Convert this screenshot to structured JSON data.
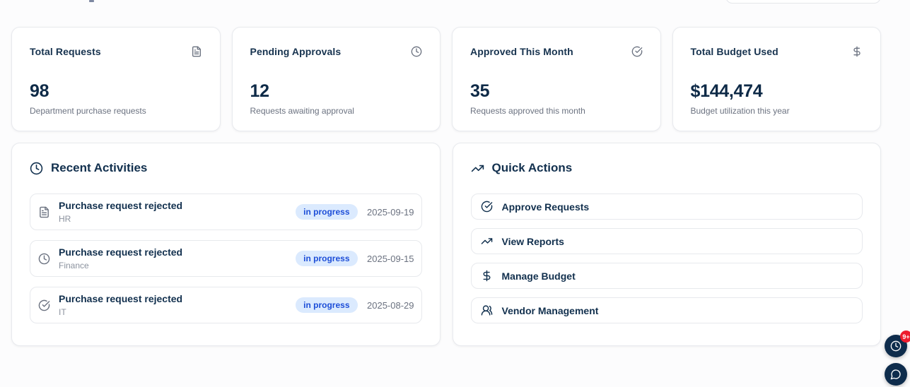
{
  "stats": [
    {
      "title": "Total Requests",
      "icon": "file-text-icon",
      "value": "98",
      "subtitle": "Department purchase requests"
    },
    {
      "title": "Pending Approvals",
      "icon": "clock-icon",
      "value": "12",
      "subtitle": "Requests awaiting approval"
    },
    {
      "title": "Approved This Month",
      "icon": "check-circle-icon",
      "value": "35",
      "subtitle": "Requests approved this month"
    },
    {
      "title": "Total Budget Used",
      "icon": "dollar-icon",
      "value": "$144,474",
      "subtitle": "Budget utilization this year"
    }
  ],
  "recent_activities": {
    "title": "Recent Activities",
    "items": [
      {
        "icon": "file-text-icon",
        "title": "Purchase request rejected",
        "department": "HR",
        "status": "in progress",
        "date": "2025-09-19"
      },
      {
        "icon": "clock-icon",
        "title": "Purchase request rejected",
        "department": "Finance",
        "status": "in progress",
        "date": "2025-09-15"
      },
      {
        "icon": "check-circle-icon",
        "title": "Purchase request rejected",
        "department": "IT",
        "status": "in progress",
        "date": "2025-08-29"
      }
    ]
  },
  "quick_actions": {
    "title": "Quick Actions",
    "actions": [
      {
        "icon": "check-circle-icon",
        "label": "Approve Requests"
      },
      {
        "icon": "trending-up-icon",
        "label": "View Reports"
      },
      {
        "icon": "dollar-icon",
        "label": "Manage Budget"
      },
      {
        "icon": "users-icon",
        "label": "Vendor Management"
      }
    ]
  },
  "floating": {
    "notification_count": "9+"
  },
  "colors": {
    "navy": "#0e2c4c",
    "title_text": "#17334f",
    "muted_text": "#6b7280",
    "badge_bg": "#dbeafe",
    "badge_text": "#1d4ed8",
    "notification_red": "#ed1c2e",
    "card_border": "#e8eaee"
  }
}
